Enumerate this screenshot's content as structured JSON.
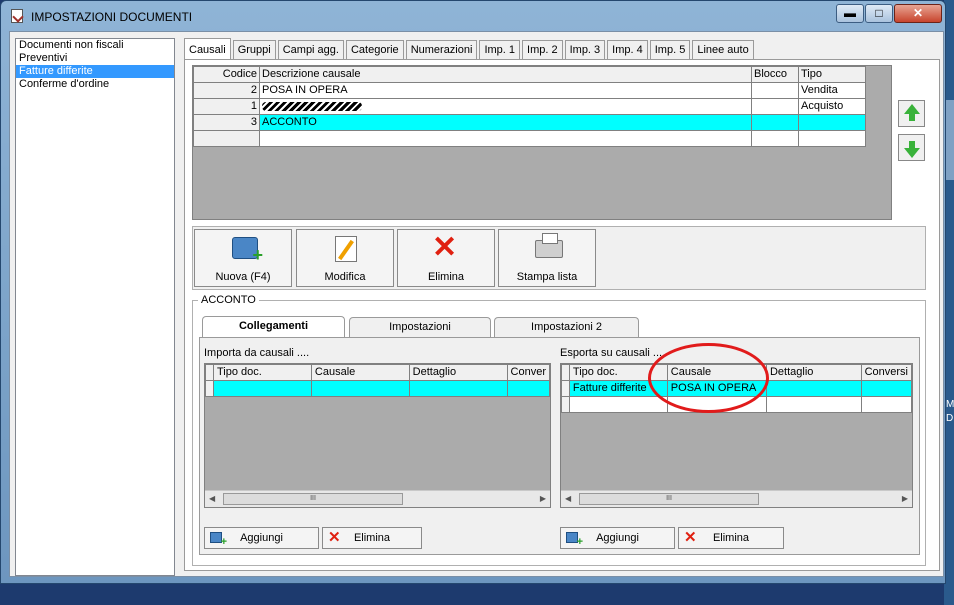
{
  "window": {
    "title": "IMPOSTAZIONI DOCUMENTI",
    "buttons": {
      "minimize": "▬",
      "maximize": "□",
      "close": "✕"
    }
  },
  "doc_types": [
    "Documenti non fiscali",
    "Preventivi",
    "Fatture differite",
    "Conferme d'ordine"
  ],
  "tabs": [
    "Causali",
    "Gruppi",
    "Campi agg.",
    "Categorie",
    "Numerazioni",
    "Imp. 1",
    "Imp. 2",
    "Imp. 3",
    "Imp. 4",
    "Imp. 5",
    "Linee auto"
  ],
  "causali": {
    "columns": [
      "Codice",
      "Descrizione causale",
      "Blocco",
      "Tipo"
    ],
    "rows": [
      {
        "codice": "2",
        "descrizione": "POSA IN OPERA",
        "blocco": "",
        "tipo": "Vendita"
      },
      {
        "codice": "1",
        "descrizione": "",
        "blocco": "",
        "tipo": "Acquisto"
      },
      {
        "codice": "3",
        "descrizione": "ACCONTO",
        "blocco": "",
        "tipo": ""
      }
    ]
  },
  "toolbar": {
    "nuova": "Nuova (F4)",
    "modifica": "Modifica",
    "elimina": "Elimina",
    "stampa": "Stampa lista"
  },
  "detail": {
    "group_title": "ACCONTO",
    "subtabs": [
      "Collegamenti",
      "Impostazioni",
      "Impostazioni 2"
    ],
    "importa": {
      "title": "Importa da causali ....",
      "columns": [
        "Tipo doc.",
        "Causale",
        "Dettaglio",
        "Conver"
      ],
      "rows": []
    },
    "esporta": {
      "title": "Esporta su causali ....",
      "columns": [
        "Tipo doc.",
        "Causale",
        "Dettaglio",
        "Conversi"
      ],
      "rows": [
        {
          "tipo_doc": "Fatture differite",
          "causale": "POSA IN OPERA",
          "dettaglio": "",
          "conversione": ""
        }
      ]
    },
    "scroll_thumb": "III",
    "aggiungi": "Aggiungi",
    "elimina": "Elimina"
  },
  "desktop_right_text": [
    "M",
    "D"
  ]
}
